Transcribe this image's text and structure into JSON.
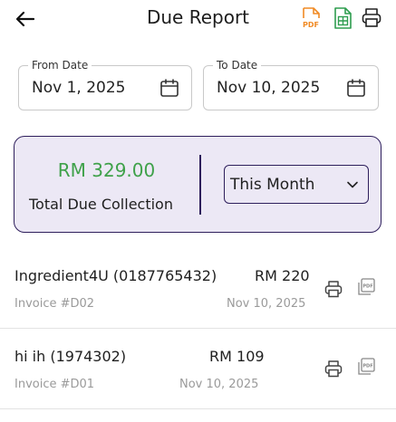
{
  "header": {
    "title": "Due Report",
    "icons": {
      "back": "arrow-left",
      "pdf": "pdf-file",
      "excel": "spreadsheet-file",
      "print": "printer"
    }
  },
  "filters": {
    "from": {
      "label": "From Date",
      "value": "Nov 1, 2025",
      "icon": "calendar"
    },
    "to": {
      "label": "To Date",
      "value": "Nov 10, 2025",
      "icon": "calendar"
    }
  },
  "summary": {
    "amount": "RM 329.00",
    "label": "Total Due Collection",
    "period": "This Month"
  },
  "dues": [
    {
      "customer": "Ingredient4U (0187765432)",
      "amount": "RM 220",
      "invoice": "Invoice #D02",
      "date": "Nov 10, 2025"
    },
    {
      "customer": "hi ih (1974302)",
      "amount": "RM 109",
      "invoice": "Invoice #D01",
      "date": "Nov 10, 2025"
    }
  ],
  "colors": {
    "accent": "#2e1f5c",
    "card_bg": "#ece8f5",
    "amount_green": "#3fa14a",
    "pdf_orange": "#f08a24",
    "excel_green": "#2e9d4f"
  }
}
